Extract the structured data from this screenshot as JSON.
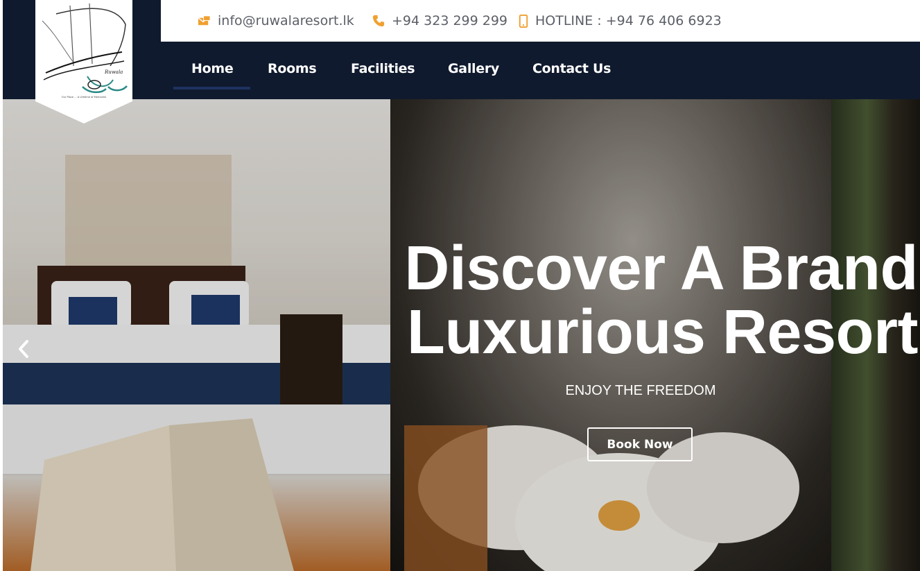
{
  "topbar": {
    "email": "info@ruwalaresort.lk",
    "phone": "+94 323 299 299",
    "hotline": "HOTLINE : +94 76 406 6923"
  },
  "nav": {
    "items": [
      {
        "label": "Home"
      },
      {
        "label": "Rooms"
      },
      {
        "label": "Facilities"
      },
      {
        "label": "Gallery"
      },
      {
        "label": "Contact Us"
      }
    ],
    "active": "Home"
  },
  "hero": {
    "title_line1": "Discover A Brand",
    "title_line2": "Luxurious Resort",
    "subtitle": "ENJOY THE FREEDOM",
    "button_label": "Book Now"
  },
  "logo": {
    "name": "Ruwala",
    "tagline": "Our Place ... A Lifetime of Memories"
  },
  "colors": {
    "header_bg": "#101a2e",
    "accent": "#f0a030",
    "active_underline": "#1d3160"
  },
  "icons": [
    "email-icon",
    "phone-icon",
    "mobile-icon",
    "chevron-left-icon"
  ]
}
